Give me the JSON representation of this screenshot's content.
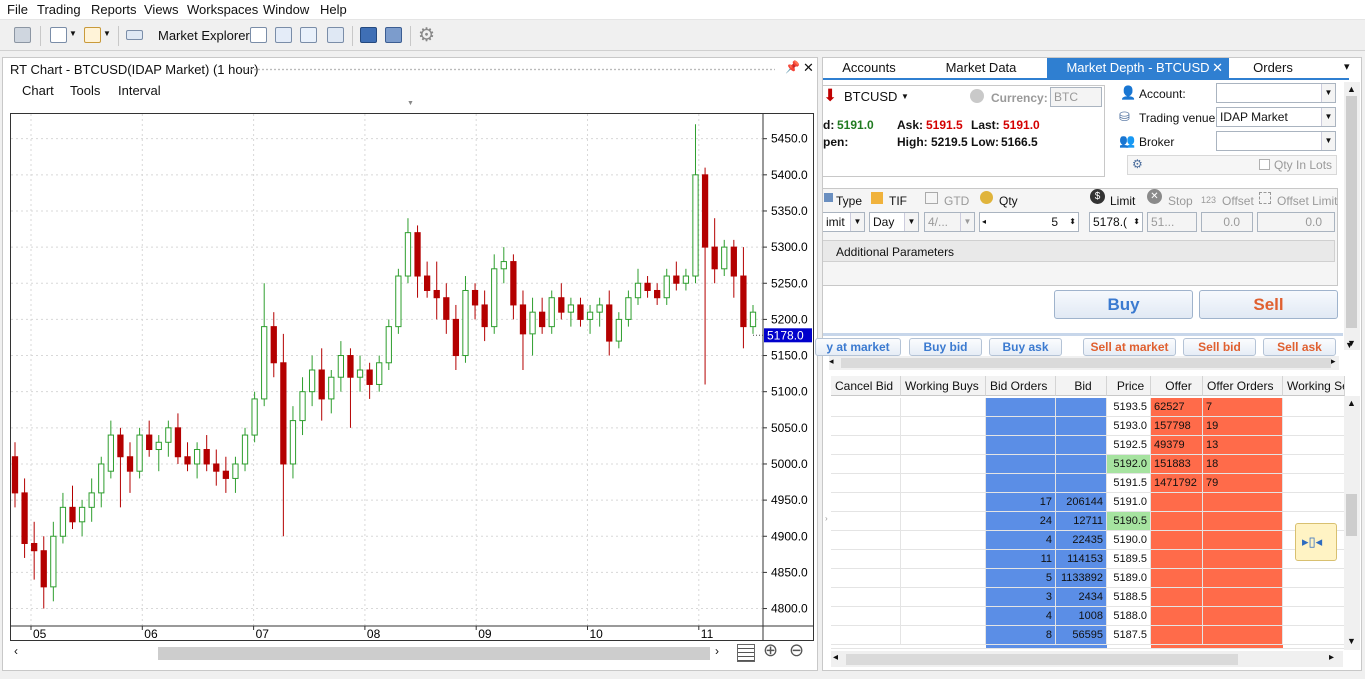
{
  "menu": [
    "File",
    "Trading",
    "Reports",
    "Views",
    "Workspaces",
    "Window",
    "Help"
  ],
  "toolbar": {
    "market_explorer": "Market Explorer"
  },
  "chart_panel": {
    "title": "RT Chart - BTCUSD(IDAP Market) (1 hour)",
    "menu": [
      "Chart",
      "Tools",
      "Interval"
    ]
  },
  "chart_data": {
    "type": "candlestick",
    "x_ticks": [
      "05",
      "06",
      "07",
      "08",
      "09",
      "10",
      "11"
    ],
    "y_ticks": [
      4800,
      4850,
      4900,
      4950,
      5000,
      5050,
      5100,
      5150,
      5200,
      5250,
      5300,
      5350,
      5400,
      5450
    ],
    "ylim": [
      4780,
      5480
    ],
    "current_price": "5178.0",
    "current_value": 5178.0,
    "colors": {
      "up": "#2e9e2e",
      "down": "#b40000",
      "price_tag": "#0000cc"
    },
    "candles": [
      [
        5010,
        5030,
        4940,
        4960
      ],
      [
        4960,
        4980,
        4870,
        4890
      ],
      [
        4890,
        4920,
        4840,
        4880
      ],
      [
        4880,
        4900,
        4800,
        4830
      ],
      [
        4830,
        4920,
        4810,
        4900
      ],
      [
        4900,
        4960,
        4890,
        4940
      ],
      [
        4940,
        4970,
        4910,
        4920
      ],
      [
        4920,
        4950,
        4900,
        4940
      ],
      [
        4940,
        4980,
        4920,
        4960
      ],
      [
        4960,
        5010,
        4940,
        5000
      ],
      [
        4990,
        5060,
        4980,
        5040
      ],
      [
        5040,
        5050,
        4940,
        5010
      ],
      [
        5010,
        5030,
        4960,
        4990
      ],
      [
        4990,
        5050,
        4980,
        5040
      ],
      [
        5040,
        5060,
        5010,
        5020
      ],
      [
        5020,
        5040,
        4990,
        5030
      ],
      [
        5030,
        5060,
        5010,
        5050
      ],
      [
        5050,
        5070,
        5000,
        5010
      ],
      [
        5010,
        5030,
        4990,
        5000
      ],
      [
        5000,
        5030,
        4980,
        5020
      ],
      [
        5020,
        5040,
        4990,
        5000
      ],
      [
        5000,
        5020,
        4970,
        4990
      ],
      [
        4990,
        5010,
        4960,
        4980
      ],
      [
        4980,
        5010,
        4960,
        5000
      ],
      [
        5000,
        5050,
        4990,
        5040
      ],
      [
        5040,
        5100,
        5030,
        5090
      ],
      [
        5090,
        5250,
        5080,
        5190
      ],
      [
        5190,
        5210,
        5120,
        5140
      ],
      [
        5140,
        5180,
        4900,
        5000
      ],
      [
        5000,
        5080,
        4980,
        5060
      ],
      [
        5060,
        5120,
        5040,
        5100
      ],
      [
        5100,
        5150,
        5080,
        5130
      ],
      [
        5130,
        5160,
        5060,
        5090
      ],
      [
        5090,
        5130,
        5070,
        5120
      ],
      [
        5120,
        5170,
        5100,
        5150
      ],
      [
        5150,
        5160,
        5050,
        5120
      ],
      [
        5120,
        5150,
        5100,
        5130
      ],
      [
        5130,
        5140,
        5090,
        5110
      ],
      [
        5110,
        5150,
        5100,
        5140
      ],
      [
        5140,
        5200,
        5130,
        5190
      ],
      [
        5190,
        5270,
        5180,
        5260
      ],
      [
        5260,
        5340,
        5250,
        5320
      ],
      [
        5320,
        5330,
        5230,
        5260
      ],
      [
        5260,
        5280,
        5230,
        5240
      ],
      [
        5240,
        5280,
        5200,
        5230
      ],
      [
        5230,
        5250,
        5180,
        5200
      ],
      [
        5200,
        5220,
        5130,
        5150
      ],
      [
        5150,
        5260,
        5140,
        5240
      ],
      [
        5240,
        5250,
        5200,
        5220
      ],
      [
        5220,
        5240,
        5170,
        5190
      ],
      [
        5190,
        5290,
        5180,
        5270
      ],
      [
        5270,
        5300,
        5250,
        5280
      ],
      [
        5280,
        5290,
        5200,
        5220
      ],
      [
        5220,
        5240,
        5130,
        5180
      ],
      [
        5180,
        5230,
        5150,
        5210
      ],
      [
        5210,
        5230,
        5180,
        5190
      ],
      [
        5190,
        5240,
        5180,
        5230
      ],
      [
        5230,
        5250,
        5200,
        5210
      ],
      [
        5210,
        5230,
        5190,
        5220
      ],
      [
        5220,
        5230,
        5190,
        5200
      ],
      [
        5200,
        5220,
        5180,
        5210
      ],
      [
        5210,
        5230,
        5190,
        5220
      ],
      [
        5220,
        5240,
        5150,
        5170
      ],
      [
        5170,
        5210,
        5160,
        5200
      ],
      [
        5200,
        5240,
        5190,
        5230
      ],
      [
        5230,
        5270,
        5220,
        5250
      ],
      [
        5250,
        5260,
        5230,
        5240
      ],
      [
        5240,
        5250,
        5220,
        5230
      ],
      [
        5230,
        5270,
        5220,
        5260
      ],
      [
        5260,
        5280,
        5240,
        5250
      ],
      [
        5250,
        5270,
        5240,
        5260
      ],
      [
        5260,
        5470,
        5250,
        5400
      ],
      [
        5400,
        5410,
        5110,
        5300
      ],
      [
        5300,
        5340,
        5250,
        5270
      ],
      [
        5270,
        5310,
        5260,
        5300
      ],
      [
        5300,
        5310,
        5230,
        5260
      ],
      [
        5260,
        5300,
        5160,
        5190
      ],
      [
        5190,
        5220,
        5180,
        5210
      ]
    ]
  },
  "right_panel": {
    "tabs": [
      "Accounts",
      "Market Data",
      "Market Depth - BTCUSD",
      "Orders"
    ],
    "symbol": "BTCUSD",
    "currency_label": "Currency:",
    "currency_value": "BTC",
    "bid_label": "d:",
    "bid": "5191.0",
    "ask_label": "Ask:",
    "ask": "5191.5",
    "last_label": "Last:",
    "last": "5191.0",
    "open_label": "pen:",
    "high_label": "High:",
    "high": "5219.5",
    "low_label": "Low:",
    "low": "5166.5",
    "account_label": "Account:",
    "trading_venue_label": "Trading venue:",
    "trading_venue": "IDAP Market",
    "broker_label": "Broker",
    "qty_in_lots": "Qty In Lots",
    "order_fields": {
      "type": "Type",
      "tif": "TIF",
      "gtd": "GTD",
      "qty": "Qty",
      "limit": "Limit",
      "stop": "Stop",
      "offset": "Offset",
      "offset_limit": "Offset Limit",
      "type_value": "imit",
      "tif_value": "Day",
      "gtd_value": "4/...",
      "qty_value": "5",
      "limit_value": "5178.(",
      "stop_value": "51...",
      "offset_value": "0.0",
      "offset_limit_value": "0.0"
    },
    "additional_parameters": "Additional Parameters",
    "buy": "Buy",
    "sell": "Sell",
    "quick_buttons": [
      "y at market",
      "Buy bid",
      "Buy ask",
      "Sell at market",
      "Sell bid",
      "Sell ask"
    ],
    "grid": {
      "headers": [
        "Cancel Bid",
        "Working Buys",
        "Bid Orders",
        "Bid",
        "Price",
        "Offer",
        "Offer Orders",
        "Working Sells"
      ],
      "rows": [
        {
          "bid_orders": "",
          "bid": "",
          "price": "5193.5",
          "offer": "62527",
          "offer_orders": "7",
          "hl": false
        },
        {
          "bid_orders": "",
          "bid": "",
          "price": "5193.0",
          "offer": "157798",
          "offer_orders": "19",
          "hl": false
        },
        {
          "bid_orders": "",
          "bid": "",
          "price": "5192.5",
          "offer": "49379",
          "offer_orders": "13",
          "hl": false
        },
        {
          "bid_orders": "",
          "bid": "",
          "price": "5192.0",
          "offer": "151883",
          "offer_orders": "18",
          "hl": true
        },
        {
          "bid_orders": "",
          "bid": "",
          "price": "5191.5",
          "offer": "1471792",
          "offer_orders": "79",
          "hl": false
        },
        {
          "bid_orders": "17",
          "bid": "206144",
          "price": "5191.0",
          "offer": "",
          "offer_orders": "",
          "hl": false
        },
        {
          "bid_orders": "24",
          "bid": "12711",
          "price": "5190.5",
          "offer": "",
          "offer_orders": "",
          "hl": true
        },
        {
          "bid_orders": "4",
          "bid": "22435",
          "price": "5190.0",
          "offer": "",
          "offer_orders": "",
          "hl": false
        },
        {
          "bid_orders": "11",
          "bid": "114153",
          "price": "5189.5",
          "offer": "",
          "offer_orders": "",
          "hl": false
        },
        {
          "bid_orders": "5",
          "bid": "1133892",
          "price": "5189.0",
          "offer": "",
          "offer_orders": "",
          "hl": false
        },
        {
          "bid_orders": "3",
          "bid": "2434",
          "price": "5188.5",
          "offer": "",
          "offer_orders": "",
          "hl": false
        },
        {
          "bid_orders": "4",
          "bid": "1008",
          "price": "5188.0",
          "offer": "",
          "offer_orders": "",
          "hl": false
        },
        {
          "bid_orders": "8",
          "bid": "56595",
          "price": "5187.5",
          "offer": "",
          "offer_orders": "",
          "hl": false
        }
      ]
    }
  }
}
